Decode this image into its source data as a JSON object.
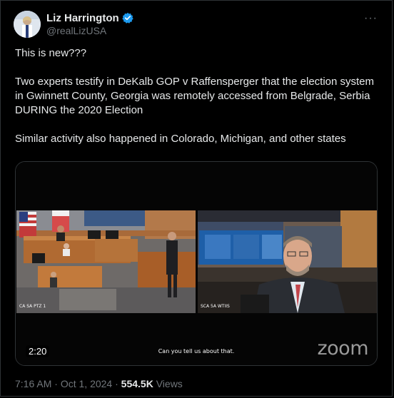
{
  "author": {
    "display_name": "Liz Harrington",
    "handle": "@realLizUSA",
    "verified": true,
    "avatar_icon": "avatar-photo"
  },
  "menu": {
    "more_label": "···"
  },
  "tweet": {
    "text": "This is new???\n\nTwo experts testify in DeKalb GOP v Raffensperger that the election system in Gwinnett County, Georgia was remotely accessed from Belgrade, Serbia DURING the 2020 Election\n\nSimilar activity also happened in Colorado, Michigan, and other states"
  },
  "video": {
    "duration": "2:20",
    "caption": "Can you tell us about that.",
    "watermark": "zoom",
    "left_cam_label": "CA SA PTZ 1",
    "right_cam_label": "SCA 5A WTIIS"
  },
  "meta": {
    "time": "7:16 AM",
    "date": "Oct 1, 2024",
    "separator": "·",
    "views_count": "554.5K",
    "views_label": "Views"
  },
  "colors": {
    "accent": "#1d9bf0",
    "muted": "#71767b",
    "text": "#e7e9ea",
    "background": "#000000"
  }
}
